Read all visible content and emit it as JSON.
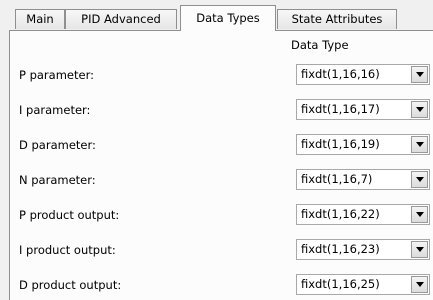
{
  "tabs": [
    {
      "label": "Main",
      "active": false
    },
    {
      "label": "PID Advanced",
      "active": false
    },
    {
      "label": "Data Types",
      "active": true
    },
    {
      "label": "State Attributes",
      "active": false
    }
  ],
  "table": {
    "column_header": "Data Type",
    "rows": [
      {
        "label": "P parameter:",
        "value": "fixdt(1,16,16)"
      },
      {
        "label": "I parameter:",
        "value": "fixdt(1,16,17)"
      },
      {
        "label": "D parameter:",
        "value": "fixdt(1,16,19)"
      },
      {
        "label": "N parameter:",
        "value": "fixdt(1,16,7)"
      },
      {
        "label": "P product output:",
        "value": "fixdt(1,16,22)"
      },
      {
        "label": "I product output:",
        "value": "fixdt(1,16,23)"
      },
      {
        "label": "D product output:",
        "value": "fixdt(1,16,25)"
      }
    ]
  },
  "icons": {
    "dropdown": "chevron-down-icon"
  }
}
